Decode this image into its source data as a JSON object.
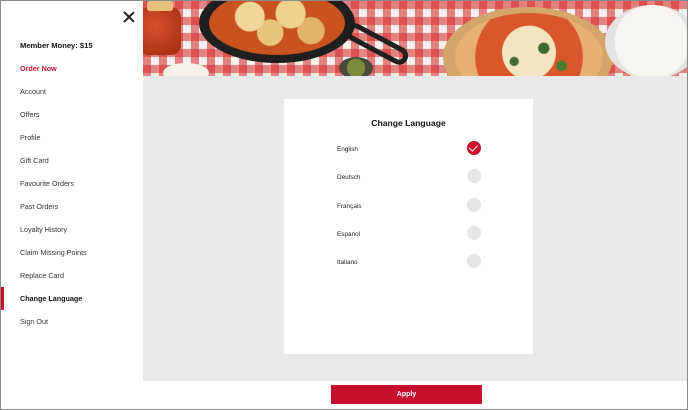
{
  "sidebar": {
    "member_money": "Member Money: $15",
    "close_icon": "close-icon",
    "items": [
      {
        "label": "Order Now",
        "style": "red"
      },
      {
        "label": "Account"
      },
      {
        "label": "Offers"
      },
      {
        "label": "Profile"
      },
      {
        "label": "Gift Card"
      },
      {
        "label": "Favourite Orders"
      },
      {
        "label": "Past Orders"
      },
      {
        "label": "Loyalty History"
      },
      {
        "label": "Claim Missing Points"
      },
      {
        "label": "Replace Card"
      },
      {
        "label": "Change Language",
        "active": true
      },
      {
        "label": "Sign Out"
      }
    ]
  },
  "language_card": {
    "title": "Change Language",
    "selected": "English",
    "options": [
      {
        "label": "English",
        "checked": true
      },
      {
        "label": "Deutsch",
        "checked": false
      },
      {
        "label": "Français",
        "checked": false
      },
      {
        "label": "Espanol",
        "checked": false
      },
      {
        "label": "Italiano",
        "checked": false
      }
    ]
  },
  "footer": {
    "apply_label": "Apply"
  },
  "colors": {
    "accent": "#c8102e",
    "page_background": "#e9e9e9",
    "radio_unselected": "#e6e6e6"
  }
}
